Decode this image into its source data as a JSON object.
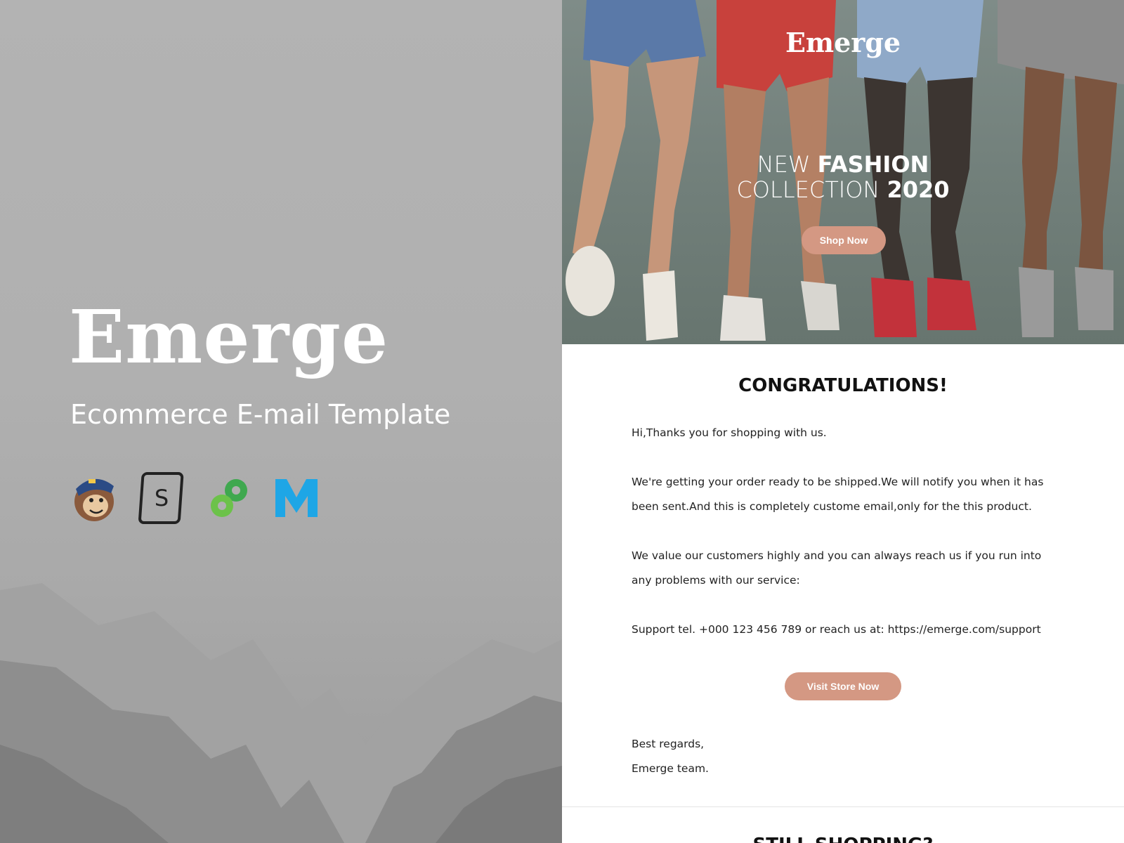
{
  "promo": {
    "brand": "Emerge",
    "tagline": "Ecommerce E-mail Template",
    "platforms": [
      "mailchimp-icon",
      "stampready-icon",
      "campaign-monitor-icon",
      "mailster-icon"
    ],
    "stampready_letter": "S"
  },
  "email": {
    "logo": "Emerge",
    "hero": {
      "line1_light": "NEW ",
      "line1_bold": "FASHION",
      "line2_light": "COLLECTION ",
      "line2_bold": "2020",
      "button": "Shop Now"
    },
    "heading": "CONGRATULATIONS!",
    "greeting": "Hi,Thanks you for shopping with us.",
    "paragraph1": "We're getting your order ready to be shipped.We will notify you when it has been sent.And this is completely custome email,only for the this product.",
    "paragraph2": "We value our customers highly and you can always reach us if you run into any problems with our service:",
    "support": "Support tel. +000 123 456 789  or reach us at: https://emerge.com/support",
    "visit_button": "Visit Store Now",
    "regards_line1": "Best regards,",
    "regards_line2": "Emerge team.",
    "next_heading": "STILL SHOPPING?"
  },
  "colors": {
    "accent": "#d49883",
    "hero_bg": "#72807b",
    "left_bg": "#b3b3b3"
  }
}
